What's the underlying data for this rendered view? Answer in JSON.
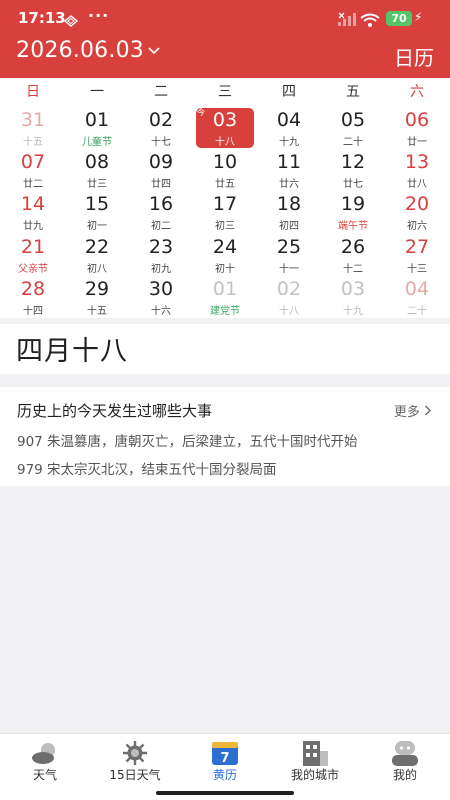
{
  "status_bar": {
    "time": "17:13",
    "dots": "···",
    "battery": "70"
  },
  "header": {
    "date": "2026.06.03",
    "right_label": "日历"
  },
  "weekdays": [
    "日",
    "一",
    "二",
    "三",
    "四",
    "五",
    "六"
  ],
  "calendar": {
    "rows": [
      [
        {
          "d": "31",
          "l": "十五",
          "muted": true
        },
        {
          "d": "01",
          "l": "儿童节",
          "fest": "green"
        },
        {
          "d": "02",
          "l": "十七"
        },
        {
          "d": "03",
          "l": "十八",
          "selected": true,
          "badge": "今"
        },
        {
          "d": "04",
          "l": "十九"
        },
        {
          "d": "05",
          "l": "二十"
        },
        {
          "d": "06",
          "l": "廿一"
        }
      ],
      [
        {
          "d": "07",
          "l": "廿二"
        },
        {
          "d": "08",
          "l": "廿三"
        },
        {
          "d": "09",
          "l": "廿四"
        },
        {
          "d": "10",
          "l": "廿五"
        },
        {
          "d": "11",
          "l": "廿六"
        },
        {
          "d": "12",
          "l": "廿七"
        },
        {
          "d": "13",
          "l": "廿八"
        }
      ],
      [
        {
          "d": "14",
          "l": "廿九"
        },
        {
          "d": "15",
          "l": "初一"
        },
        {
          "d": "16",
          "l": "初二"
        },
        {
          "d": "17",
          "l": "初三"
        },
        {
          "d": "18",
          "l": "初四"
        },
        {
          "d": "19",
          "l": "端午节",
          "fest": "red"
        },
        {
          "d": "20",
          "l": "初六"
        }
      ],
      [
        {
          "d": "21",
          "l": "父亲节",
          "fest": "red"
        },
        {
          "d": "22",
          "l": "初八"
        },
        {
          "d": "23",
          "l": "初九"
        },
        {
          "d": "24",
          "l": "初十"
        },
        {
          "d": "25",
          "l": "十一"
        },
        {
          "d": "26",
          "l": "十二"
        },
        {
          "d": "27",
          "l": "十三"
        }
      ],
      [
        {
          "d": "28",
          "l": "十四"
        },
        {
          "d": "29",
          "l": "十五"
        },
        {
          "d": "30",
          "l": "十六"
        },
        {
          "d": "01",
          "l": "建党节",
          "muted": true,
          "fest": "green"
        },
        {
          "d": "02",
          "l": "十八",
          "muted": true
        },
        {
          "d": "03",
          "l": "十九",
          "muted": true
        },
        {
          "d": "04",
          "l": "二十",
          "muted": true
        }
      ]
    ]
  },
  "lunar_date": "四月十八",
  "history": {
    "title": "历史上的今天发生过哪些大事",
    "more": "更多",
    "items": [
      "907 朱温篡唐，唐朝灭亡，后梁建立，五代十国时代开始",
      "979 宋太宗灭北汉，结束五代十国分裂局面"
    ]
  },
  "tabs": [
    {
      "label": "天气",
      "icon": "weather-cloud-icon"
    },
    {
      "label": "15日天气",
      "icon": "sun-gear-icon"
    },
    {
      "label": "黄历",
      "icon": "calendar-icon",
      "active": true,
      "icon_text": "7"
    },
    {
      "label": "我的城市",
      "icon": "city-building-icon"
    },
    {
      "label": "我的",
      "icon": "profile-icon"
    }
  ],
  "colors": {
    "brand_red": "#d8403e",
    "active_tab": "#2d6fd1",
    "festival_green": "#3aa35c"
  }
}
